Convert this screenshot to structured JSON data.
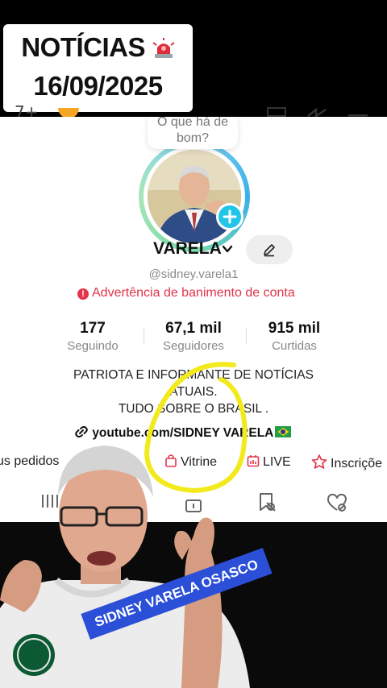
{
  "headline": {
    "line1": "NOTÍCIAS",
    "line2": "16/09/2025"
  },
  "profile": {
    "bubble_text": "O que há de bom?",
    "name": "VARELA",
    "handle": "@sidney.varela1",
    "warning": "Advertência de banimento de conta",
    "stats": [
      {
        "value": "177",
        "label": "Seguindo"
      },
      {
        "value": "67,1 mil",
        "label": "Seguidores"
      },
      {
        "value": "915 mil",
        "label": "Curtidas"
      }
    ],
    "bio": [
      "PATRIOTA E INFORMANTE DE NOTÍCIAS",
      "ATUAIS.",
      "TUDO SOBRE O BRASIL ."
    ],
    "link": "youtube.com/SIDNEY VARELA",
    "shortcuts": [
      "us pedidos",
      "Vitrine",
      "LIVE",
      "Inscriçõe"
    ]
  },
  "overlay": {
    "banner": "SIDNEY VARELA OSASCO"
  },
  "colors": {
    "accent": "#20c5e8",
    "warning": "#e2344a",
    "banner": "#2b4fd6",
    "marker": "#f2ea1c"
  }
}
